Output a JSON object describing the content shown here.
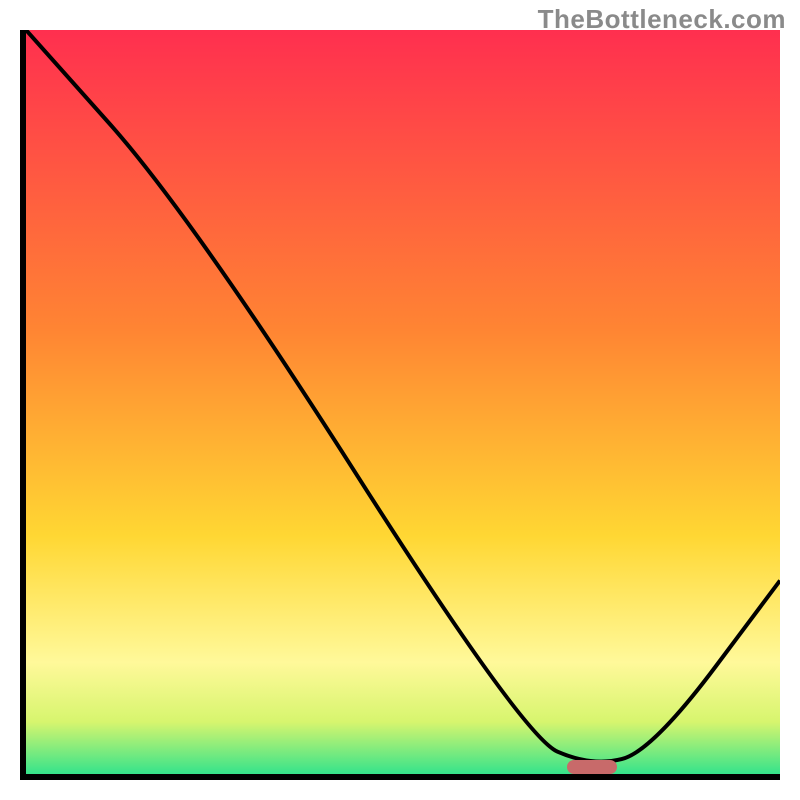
{
  "watermark": "TheBottleneck.com",
  "chart_data": {
    "type": "line",
    "title": "",
    "xlabel": "",
    "ylabel": "",
    "xlim": [
      0,
      100
    ],
    "ylim": [
      0,
      100
    ],
    "gradient_stops_pct": [
      {
        "offset": 0,
        "color": "#ff2f4f"
      },
      {
        "offset": 40,
        "color": "#ff8433"
      },
      {
        "offset": 68,
        "color": "#ffd733"
      },
      {
        "offset": 85,
        "color": "#fff99a"
      },
      {
        "offset": 93,
        "color": "#d7f56e"
      },
      {
        "offset": 100,
        "color": "#35e38b"
      }
    ],
    "curve": {
      "x": [
        0,
        22,
        66,
        75,
        83,
        100
      ],
      "y": [
        100,
        75,
        5,
        1,
        3,
        26
      ]
    },
    "marker": {
      "x": 75,
      "y": 1
    }
  }
}
